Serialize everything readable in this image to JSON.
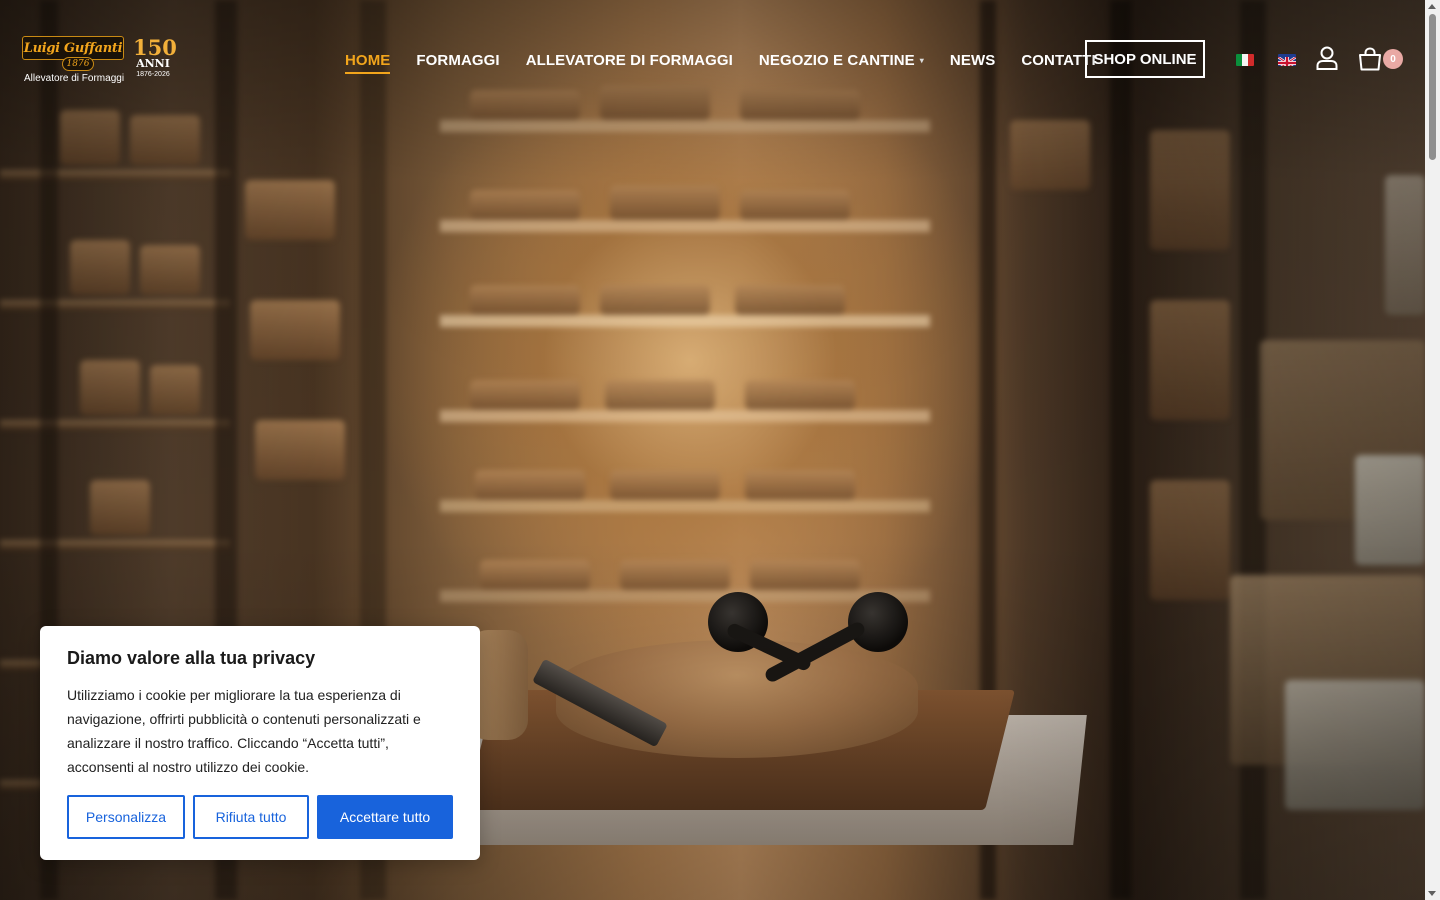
{
  "brand": {
    "logo_name": "Luigi Guffanti",
    "logo_year": "1876",
    "tagline": "Allevatore di Formaggi",
    "anniversary_number": "150",
    "anniversary_word": "ANNI",
    "anniversary_range": "1876-2026",
    "accent_color": "#f2a51c"
  },
  "nav": {
    "items": [
      {
        "label": "HOME",
        "active": true
      },
      {
        "label": "FORMAGGI",
        "active": false
      },
      {
        "label": "ALLEVATORE DI FORMAGGI",
        "active": false
      },
      {
        "label": "NEGOZIO E CANTINE",
        "active": false,
        "has_dropdown": true
      },
      {
        "label": "NEWS",
        "active": false
      },
      {
        "label": "CONTATTI",
        "active": false
      }
    ],
    "shop_button": "SHOP ONLINE"
  },
  "header_icons": {
    "languages": [
      "it-flag-icon",
      "uk-flag-icon"
    ],
    "account_icon": "user-icon",
    "cart_icon": "shopping-bag-icon",
    "cart_count": "0"
  },
  "cookie_banner": {
    "title": "Diamo valore alla tua privacy",
    "body": "Utilizziamo i cookie per migliorare la tua esperienza di navigazione, offrirti pubblicità o contenuti personalizzati e analizzare il nostro traffico. Cliccando “Accetta tutti”, acconsenti al nostro utilizzo dei cookie.",
    "buttons": {
      "customize": "Personalizza",
      "reject": "Rifiuta tutto",
      "accept": "Accettare tutto"
    },
    "primary_color": "#1863dc"
  }
}
